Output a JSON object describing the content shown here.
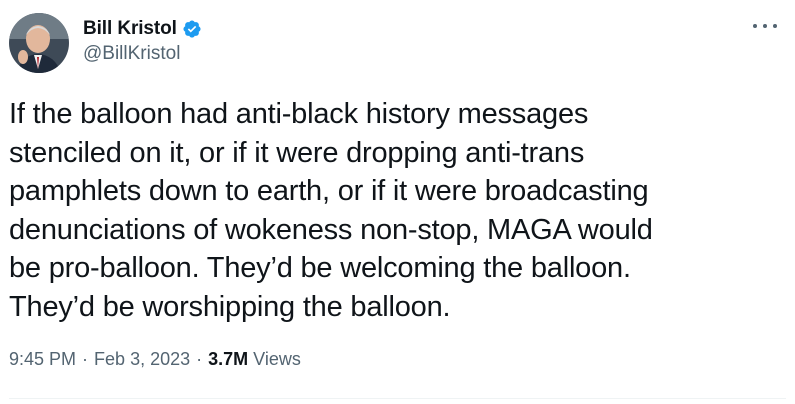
{
  "author": {
    "display_name": "Bill Kristol",
    "handle": "@BillKristol",
    "verified_icon": "verified-badge-icon",
    "avatar_icon": "avatar-photo"
  },
  "tweet": {
    "text": "If the balloon had anti-black history messages\nstenciled on it, or if it were dropping anti-trans\npamphlets down to earth, or if it were broadcasting\ndenunciations of wokeness non-stop, MAGA would\nbe pro-balloon. They’d be welcoming the balloon.\nThey’d be worshipping the balloon."
  },
  "meta": {
    "time": "9:45 PM",
    "date": "Feb 3, 2023",
    "separator": "·",
    "views_count": "3.7M",
    "views_label": "Views"
  },
  "colors": {
    "text_primary": "#0f1419",
    "text_secondary": "#536471",
    "verified_blue": "#1d9bf0",
    "divider": "#eff3f4"
  },
  "more_icon": "more-horizontal-icon"
}
